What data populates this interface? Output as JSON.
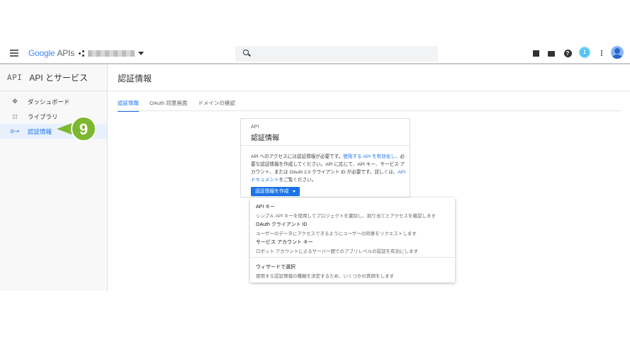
{
  "header": {
    "logo_google": "Google",
    "logo_apis": "APIs",
    "notification_count": "1"
  },
  "sidebar": {
    "mark": "API",
    "title": "API とサービス",
    "items": [
      {
        "label": "ダッシュボード"
      },
      {
        "label": "ライブラリ"
      },
      {
        "label": "認証情報"
      }
    ]
  },
  "callout": {
    "number": "9",
    "color": "#7cb82f"
  },
  "main": {
    "title": "認証情報",
    "tabs": [
      {
        "label": "認証情報"
      },
      {
        "label": "OAuth 同意画面"
      },
      {
        "label": "ドメインの確認"
      }
    ]
  },
  "card": {
    "subtitle": "API",
    "title": "認証情報",
    "desc_1": "API へのアクセスには認証情報が必要です。",
    "link_1": "使用する API を有効化し",
    "desc_2": "、必要な認証情報を作成してください。API に応じて、API キー、サービス アカウント、または OAuth 2.0 クライアント ID が必要です。詳しくは、",
    "link_2": "API ドキュメント",
    "desc_3": "をご覧ください。",
    "button": "認証情報を作成"
  },
  "menu": {
    "items": [
      {
        "title": "API キー",
        "desc": "シンプル API キーを使用してプロジェクトを識別し、割り当てとアクセスを確認します"
      },
      {
        "title": "OAuth クライアント ID",
        "desc": "ユーザーのデータにアクセスできるようにユーザーの同意をリクエストします"
      },
      {
        "title": "サービス アカウント キー",
        "desc": "ロボット アカウントによるサーバー間でのアプリレベルの認証を有効にします"
      },
      {
        "title": "ウィザードで選択",
        "desc": "使用する認証情報の種類を決定するため、いくつかの質問をします"
      }
    ]
  },
  "colors": {
    "accent": "#1a73e8"
  }
}
